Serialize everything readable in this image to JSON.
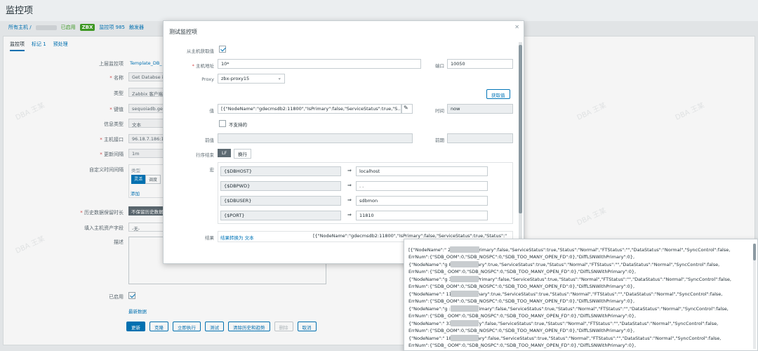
{
  "page_title": "监控项",
  "breadcrumb": {
    "all_hosts": "所有主机 /",
    "enabled": "已启用",
    "zbx": "ZBX",
    "items": "监控项 985",
    "triggers": "触发器"
  },
  "tabs": [
    "监控项",
    "标记 1",
    "预处理"
  ],
  "form": {
    "template_label": "上层监控项",
    "template_value": "Template_DB_",
    "name_label": "名称",
    "name_value": "Get Databse i",
    "type_label": "类型",
    "type_value": "Zabbix 客户端",
    "key_label": "键值",
    "key_value": "sequoiadb.get",
    "info_type_label": "信息类型",
    "info_type_value": "文本",
    "host_iface_label": "主机接口",
    "host_iface_value": "96.18.7.186:10",
    "interval_label": "更新间隔",
    "interval_value": "1m",
    "custom_label": "自定义时间间隔",
    "custom_type": "类型",
    "custom_flex": "灵活",
    "custom_sched": "调度",
    "add_link": "添加",
    "history_label": "历史数据保留时长",
    "history_value": "不保留历史数据",
    "inventory_label": "填入主机资产字段",
    "inventory_value": "-无-",
    "desc_label": "描述",
    "enabled_label": "已启用",
    "latest_link": "最新数据",
    "buttons": {
      "update": "更新",
      "clone": "克隆",
      "execute": "立即执行",
      "test": "测试",
      "clear": "清除历史和趋势",
      "delete": "删除",
      "cancel": "取消"
    }
  },
  "modal": {
    "title": "测试监控项",
    "get_from_host_label": "从主机获取值",
    "host_addr_label": "主机地址",
    "host_addr_value": "10*",
    "port_label": "端口",
    "port_value": "10050",
    "proxy_label": "Proxy",
    "proxy_value": "zbx-proxy15",
    "get_value_btn": "获取值",
    "value_label": "值",
    "value_value": "[{\"NodeName\":\"gdecmsdb2:11800\",\"IsPrimary\":false,\"ServiceStatus\":true,\"S...",
    "time_label": "时间",
    "time_value": "now",
    "not_supported": "不支持的",
    "prev_label": "前值",
    "prev_time_label": "前期",
    "eol_label": "行序结束",
    "eol_lf": "LF",
    "eol_crlf": "换行",
    "macro_label": "宏",
    "macros": [
      {
        "name": "{$DBHOST}",
        "value": "localhost"
      },
      {
        "name": "{$DBPWD}",
        "value": ". ."
      },
      {
        "name": "{$DBUSER}",
        "value": "sdbmon"
      },
      {
        "name": "{$PORT}",
        "value": "11810"
      }
    ],
    "eq": "⇒",
    "result_label": "结果",
    "result_convert": "结果转换为 文本",
    "result_value": "[{\"NodeName\":\"gdecmsdb2:11800\",\"IsPrimary\":false,\"ServiceStatus\":true,\"Status\":\""
  },
  "popup_lines": [
    "[{\"NodeName\":\"                 2:11800\",\"IsPrimary\":false,\"ServiceStatus\":true,\"Status\":\"Normal\",\"FTStatus\":\"\",\"DataStatus\":\"Normal\",\"SyncControl\":false,",
    "ErrNum\":{\"SDB_OOM\":0,\"SDB_NOSPC\":0,\"SDB_TOO_MANY_OPEN_FD\":0},\"DiffLSNWithPrimary\":0},",
    "{\"NodeName\":\"g                800\",\"IsPrimary\":true,\"ServiceStatus\":true,\"Status\":\"Normal\",\"FTStatus\":\"\",\"DataStatus\":\"Normal\",\"SyncControl\":false,",
    "ErrNum\":{\"SDB_ OOM\":0,\"SDB_NOSPC\":0,\"SDB_TOO_MANY_OPEN_FD\":0},\"DiffLSNWithPrimary\":0},",
    "{\"NodeName\":\"g               3:11800\",\"IsPrimary\":false,\"ServiceStatus\":true,\"Status\":\"Normal\",\"FTStatus\":\"\",\"DataStatus\":\"Normal\",\"SyncControl\":false,",
    "ErrNum\":{\"SDB_OOM\":0,\"SDB_NOSPC\":0,\"SDB_TOO_MANY_OPEN_FD\":0},\"DiffLSNWithPrimary\":0},",
    "{\"NodeName\":\"               11820\",\"IsPrimary\":true,\"ServiceStatus\":true,\"Status\":\"Normal\",\"FTStatus\":\"\",\"DataStatus\":\"Normal\",\"SyncControl\":false,",
    "ErrNum\":{\"SDB_OOM\":0,\"SDB_NOSPC\":0,\"SDB_TOO_MANY_OPEN_FD\":0},\"DiffLSNWithPrimary\":0},",
    "{\"NodeName\":\"g                :11820\",\"IsPrimary\":false,\"ServiceStatus\":true,\"Status\":\"Normal\",\"FTStatus\":\"\",\"DataStatus\":\"Normal\",\"SyncControl\":false,",
    "ErrNum\":{\"SDB_ OOM\":0,\"SDB_NOSPC\":0,\"SDB_TOO_MANY_OPEN_FD\":0},\"DiffLSNWithPrimary\":0},",
    "{\"NodeName\":\"                 330\",\"IsPrimary\":false,\"ServiceStatus\":true,\"Status\":\"Normal\",\"FTStatus\":\"\",\"DataStatus\":\"Normal\",\"SyncControl\":false,",
    "ErrNum\":{\"SDB_OOM\":0,\"SDB_NOSPC\":0,\"SDB_TOO_MANY_OPEN_FD\":0},\"DiffLSNWithPrimary\":0},",
    "{\"NodeName\":\"                1830\",\"IsPrimary\":false,\"ServiceStatus\":true,\"Status\":\"Normal\",\"FTStatus\":\"\",\"DataStatus\":\"Normal\",\"SyncControl\":false,",
    "ErrNum\":{\"SDB_ OOM\":0,\"SDB_NOSPC\":0,\"SDB_TOO_MANY_OPEN_FD\":0},\"DiffLSNWithPrimary\":0},"
  ]
}
